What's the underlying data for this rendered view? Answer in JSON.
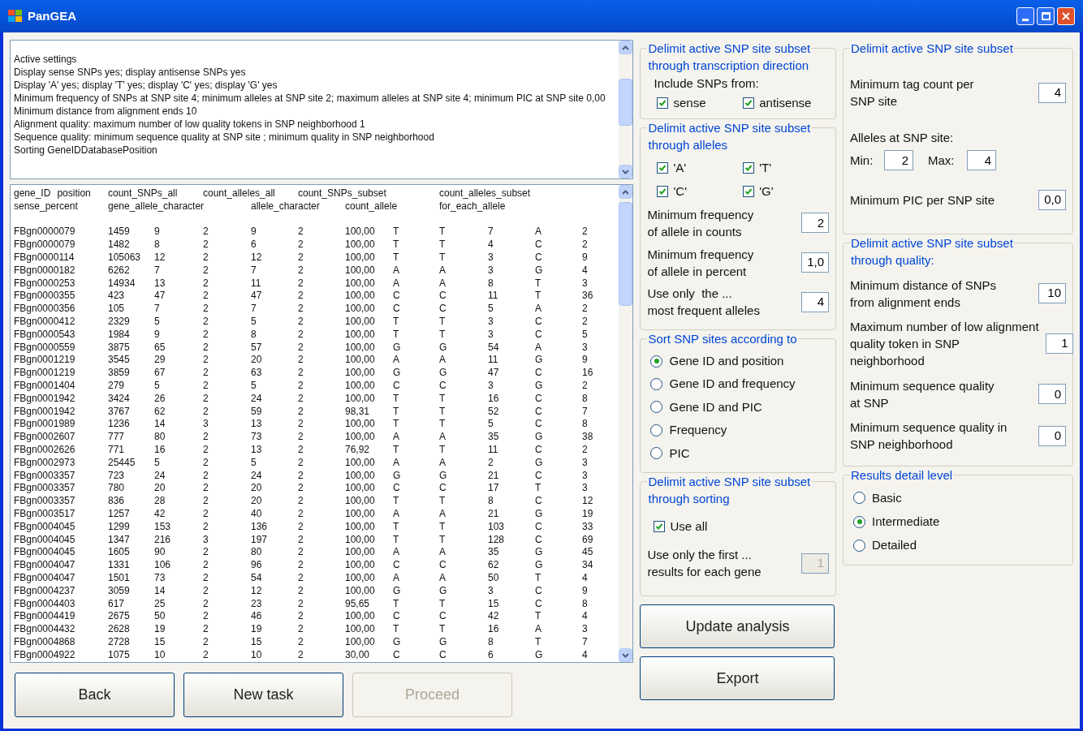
{
  "window": {
    "title": "PanGEA"
  },
  "settings_box": {
    "lines": [
      "Active settings",
      "Display sense SNPs yes; display antisense SNPs yes",
      "Display 'A' yes; display 'T' yes; display 'C' yes; display 'G' yes",
      "Minimum frequency of SNPs at SNP site 4; minimum alleles at SNP site 2; maximum alleles at SNP site 4; minimum PIC at SNP site 0,00",
      "Minimum distance from alignment ends 10",
      "Alignment quality: maximum number of low quality tokens in SNP neighborhood 1",
      "Sequence quality: minimum sequence quality at SNP site ; minimum quality in SNP neighborhood",
      "Sorting GeneIDDatabasePosition"
    ]
  },
  "results": {
    "header_lines": [
      [
        "gene_ID",
        "position",
        "count_SNPs_all",
        "count_alleles_all",
        "count_SNPs_subset",
        "count_alleles_subset"
      ],
      [
        "sense_percent",
        "gene_allele_character",
        "allele_character",
        "count_allele",
        "for_each_allele"
      ]
    ],
    "rows": [
      [
        "FBgn0000079",
        "1459",
        "9",
        "2",
        "9",
        "2",
        "100,00",
        "T",
        "T",
        "7",
        "A",
        "2"
      ],
      [
        "FBgn0000079",
        "1482",
        "8",
        "2",
        "6",
        "2",
        "100,00",
        "T",
        "T",
        "4",
        "C",
        "2"
      ],
      [
        "FBgn0000114",
        "105063",
        "12",
        "2",
        "12",
        "2",
        "100,00",
        "T",
        "T",
        "3",
        "C",
        "9"
      ],
      [
        "FBgn0000182",
        "6262",
        "7",
        "2",
        "7",
        "2",
        "100,00",
        "A",
        "A",
        "3",
        "G",
        "4"
      ],
      [
        "FBgn0000253",
        "14934",
        "13",
        "2",
        "11",
        "2",
        "100,00",
        "A",
        "A",
        "8",
        "T",
        "3"
      ],
      [
        "FBgn0000355",
        "423",
        "47",
        "2",
        "47",
        "2",
        "100,00",
        "C",
        "C",
        "11",
        "T",
        "36"
      ],
      [
        "FBgn0000356",
        "105",
        "7",
        "2",
        "7",
        "2",
        "100,00",
        "C",
        "C",
        "5",
        "A",
        "2"
      ],
      [
        "FBgn0000412",
        "2329",
        "5",
        "2",
        "5",
        "2",
        "100,00",
        "T",
        "T",
        "3",
        "C",
        "2"
      ],
      [
        "FBgn0000543",
        "1984",
        "9",
        "2",
        "8",
        "2",
        "100,00",
        "T",
        "T",
        "3",
        "C",
        "5"
      ],
      [
        "FBgn0000559",
        "3875",
        "65",
        "2",
        "57",
        "2",
        "100,00",
        "G",
        "G",
        "54",
        "A",
        "3"
      ],
      [
        "FBgn0001219",
        "3545",
        "29",
        "2",
        "20",
        "2",
        "100,00",
        "A",
        "A",
        "11",
        "G",
        "9"
      ],
      [
        "FBgn0001219",
        "3859",
        "67",
        "2",
        "63",
        "2",
        "100,00",
        "G",
        "G",
        "47",
        "C",
        "16"
      ],
      [
        "FBgn0001404",
        "279",
        "5",
        "2",
        "5",
        "2",
        "100,00",
        "C",
        "C",
        "3",
        "G",
        "2"
      ],
      [
        "FBgn0001942",
        "3424",
        "26",
        "2",
        "24",
        "2",
        "100,00",
        "T",
        "T",
        "16",
        "C",
        "8"
      ],
      [
        "FBgn0001942",
        "3767",
        "62",
        "2",
        "59",
        "2",
        "98,31",
        "T",
        "T",
        "52",
        "C",
        "7"
      ],
      [
        "FBgn0001989",
        "1236",
        "14",
        "3",
        "13",
        "2",
        "100,00",
        "T",
        "T",
        "5",
        "C",
        "8"
      ],
      [
        "FBgn0002607",
        "777",
        "80",
        "2",
        "73",
        "2",
        "100,00",
        "A",
        "A",
        "35",
        "G",
        "38"
      ],
      [
        "FBgn0002626",
        "771",
        "16",
        "2",
        "13",
        "2",
        "76,92",
        "T",
        "T",
        "11",
        "C",
        "2"
      ],
      [
        "FBgn0002973",
        "25445",
        "5",
        "2",
        "5",
        "2",
        "100,00",
        "A",
        "A",
        "2",
        "G",
        "3"
      ],
      [
        "FBgn0003357",
        "723",
        "24",
        "2",
        "24",
        "2",
        "100,00",
        "G",
        "G",
        "21",
        "C",
        "3"
      ],
      [
        "FBgn0003357",
        "780",
        "20",
        "2",
        "20",
        "2",
        "100,00",
        "C",
        "C",
        "17",
        "T",
        "3"
      ],
      [
        "FBgn0003357",
        "836",
        "28",
        "2",
        "20",
        "2",
        "100,00",
        "T",
        "T",
        "8",
        "C",
        "12"
      ],
      [
        "FBgn0003517",
        "1257",
        "42",
        "2",
        "40",
        "2",
        "100,00",
        "A",
        "A",
        "21",
        "G",
        "19"
      ],
      [
        "FBgn0004045",
        "1299",
        "153",
        "2",
        "136",
        "2",
        "100,00",
        "T",
        "T",
        "103",
        "C",
        "33"
      ],
      [
        "FBgn0004045",
        "1347",
        "216",
        "3",
        "197",
        "2",
        "100,00",
        "T",
        "T",
        "128",
        "C",
        "69"
      ],
      [
        "FBgn0004045",
        "1605",
        "90",
        "2",
        "80",
        "2",
        "100,00",
        "A",
        "A",
        "35",
        "G",
        "45"
      ],
      [
        "FBgn0004047",
        "1331",
        "106",
        "2",
        "96",
        "2",
        "100,00",
        "C",
        "C",
        "62",
        "G",
        "34"
      ],
      [
        "FBgn0004047",
        "1501",
        "73",
        "2",
        "54",
        "2",
        "100,00",
        "A",
        "A",
        "50",
        "T",
        "4"
      ],
      [
        "FBgn0004237",
        "3059",
        "14",
        "2",
        "12",
        "2",
        "100,00",
        "G",
        "G",
        "3",
        "C",
        "9"
      ],
      [
        "FBgn0004403",
        "617",
        "25",
        "2",
        "23",
        "2",
        "95,65",
        "T",
        "T",
        "15",
        "C",
        "8"
      ],
      [
        "FBgn0004419",
        "2675",
        "50",
        "2",
        "46",
        "2",
        "100,00",
        "C",
        "C",
        "42",
        "T",
        "4"
      ],
      [
        "FBgn0004432",
        "2628",
        "19",
        "2",
        "19",
        "2",
        "100,00",
        "T",
        "T",
        "16",
        "A",
        "3"
      ],
      [
        "FBgn0004868",
        "2728",
        "15",
        "2",
        "15",
        "2",
        "100,00",
        "G",
        "G",
        "8",
        "T",
        "7"
      ],
      [
        "FBgn0004922",
        "1075",
        "10",
        "2",
        "10",
        "2",
        "30,00",
        "C",
        "C",
        "6",
        "G",
        "4"
      ]
    ]
  },
  "left_buttons": [
    {
      "label": "Back",
      "disabled": false
    },
    {
      "label": "New task",
      "disabled": false
    },
    {
      "label": "Proceed",
      "disabled": true
    }
  ],
  "middle_groups": [
    {
      "title": "Delimit active SNP site subset\nthrough transcription direction",
      "items": [
        {
          "kind": "label",
          "text": "Include SNPs from:"
        },
        {
          "kind": "checkbox_row",
          "checkboxes": [
            {
              "label": "sense",
              "checked": true
            },
            {
              "label": "antisense",
              "checked": true
            }
          ]
        }
      ]
    },
    {
      "title": "Delimit active SNP site subset\nthrough alleles",
      "items": [
        {
          "kind": "checkbox_row",
          "checkboxes": [
            {
              "label": "'A'",
              "checked": true
            },
            {
              "label": "'T'",
              "checked": true
            }
          ]
        },
        {
          "kind": "checkbox_row",
          "checkboxes": [
            {
              "label": "'C'",
              "checked": true
            },
            {
              "label": "'G'",
              "checked": true
            }
          ]
        },
        {
          "kind": "field",
          "label": "Minimum frequency\nof allele in counts",
          "value": "2",
          "disabled": false
        },
        {
          "kind": "field",
          "label": "Minimum frequency\nof allele in percent",
          "value": "1,0",
          "disabled": false
        },
        {
          "kind": "field",
          "label": "Use only  the ...\nmost frequent alleles",
          "value": "4",
          "disabled": false
        }
      ]
    },
    {
      "title": "Sort SNP sites according to",
      "items": [
        {
          "kind": "radio",
          "label": "Gene ID and position",
          "selected": true
        },
        {
          "kind": "radio",
          "label": "Gene ID and frequency",
          "selected": false
        },
        {
          "kind": "radio",
          "label": "Gene ID and PIC",
          "selected": false
        },
        {
          "kind": "radio",
          "label": "Frequency",
          "selected": false
        },
        {
          "kind": "radio",
          "label": "PIC",
          "selected": false
        }
      ]
    },
    {
      "title": "Delimit active SNP site subset\nthrough sorting",
      "items": [
        {
          "kind": "checkbox",
          "label": "Use all",
          "checked": true
        },
        {
          "kind": "field",
          "label": "Use only the first ...\nresults for each gene",
          "value": "1",
          "disabled": true
        }
      ]
    }
  ],
  "action_buttons": [
    {
      "label": "Update analysis",
      "disabled": false
    },
    {
      "label": "Export",
      "disabled": false
    }
  ],
  "right_groups": [
    {
      "title": "Delimit active SNP site subset",
      "items": [
        {
          "kind": "field",
          "label": "Minimum tag count per\nSNP site",
          "value": "4",
          "disabled": false
        },
        {
          "kind": "minmax",
          "label": "Alleles at SNP site:",
          "min_label": "Min:",
          "min_value": "2",
          "max_label": "Max:",
          "max_value": "4"
        },
        {
          "kind": "field",
          "label": "Minimum PIC per SNP site",
          "value": "0,0",
          "disabled": false
        }
      ]
    },
    {
      "title": "Delimit active SNP site subset\nthrough quality:",
      "items": [
        {
          "kind": "field",
          "label": "Minimum distance of SNPs\nfrom alignment ends",
          "value": "10",
          "disabled": false
        },
        {
          "kind": "field",
          "label": "Maximum number of low alignment\nquality token in SNP\nneighborhood",
          "value": "1",
          "disabled": false
        },
        {
          "kind": "field",
          "label": "Minimum sequence quality\nat SNP",
          "value": "0",
          "disabled": false
        },
        {
          "kind": "field",
          "label": "Minimum sequence quality in\nSNP neighborhood",
          "value": "0",
          "disabled": false
        }
      ]
    },
    {
      "title": "Results detail level",
      "items": [
        {
          "kind": "radio",
          "label": "Basic",
          "selected": false
        },
        {
          "kind": "radio",
          "label": "Intermediate",
          "selected": true
        },
        {
          "kind": "radio",
          "label": "Detailed",
          "selected": false
        }
      ]
    }
  ]
}
